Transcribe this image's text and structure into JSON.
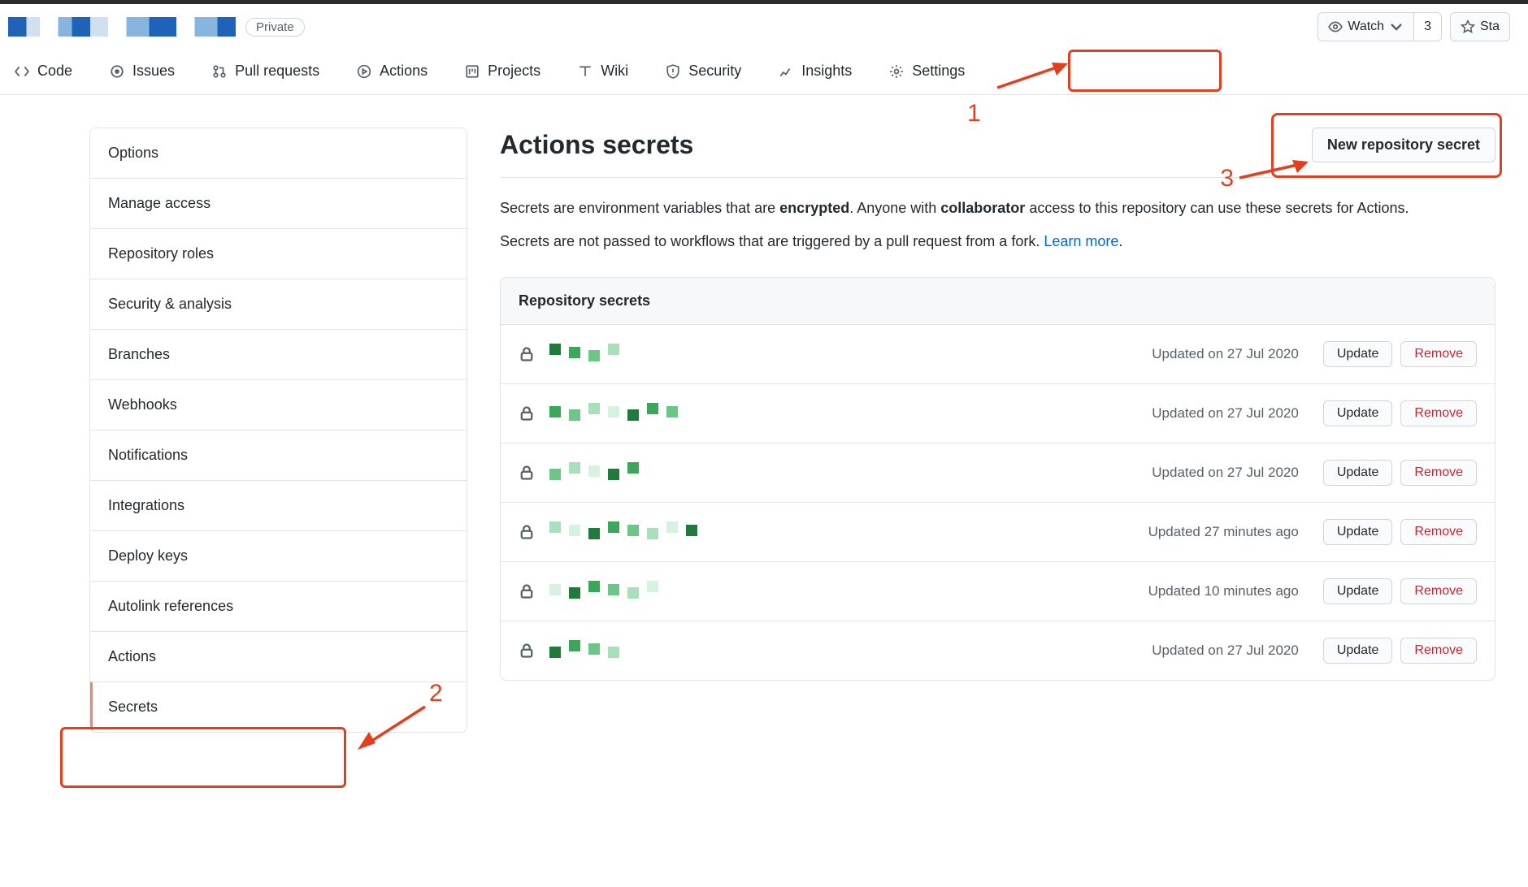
{
  "repo": {
    "visibility_badge": "Private"
  },
  "header_actions": {
    "watch_label": "Watch",
    "watch_count": "3",
    "star_label": "Sta"
  },
  "tabs": [
    {
      "icon": "code",
      "label": "Code"
    },
    {
      "icon": "issues",
      "label": "Issues"
    },
    {
      "icon": "pr",
      "label": "Pull requests"
    },
    {
      "icon": "actions",
      "label": "Actions"
    },
    {
      "icon": "projects",
      "label": "Projects"
    },
    {
      "icon": "wiki",
      "label": "Wiki"
    },
    {
      "icon": "security",
      "label": "Security"
    },
    {
      "icon": "insights",
      "label": "Insights"
    },
    {
      "icon": "settings",
      "label": "Settings"
    }
  ],
  "sidebar": {
    "items": [
      "Options",
      "Manage access",
      "Repository roles",
      "Security & analysis",
      "Branches",
      "Webhooks",
      "Notifications",
      "Integrations",
      "Deploy keys",
      "Autolink references",
      "Actions",
      "Secrets"
    ],
    "active_index": 11
  },
  "main": {
    "title": "Actions secrets",
    "new_secret_btn": "New repository secret",
    "intro_line1_a": "Secrets are environment variables that are ",
    "intro_line1_b": "encrypted",
    "intro_line1_c": ". Anyone with ",
    "intro_line1_d": "collaborator",
    "intro_line1_e": " access to this repository can use these secrets for Actions.",
    "intro_line2_a": "Secrets are not passed to workflows that are triggered by a pull request from a fork. ",
    "intro_line2_link": "Learn more",
    "intro_line2_b": "."
  },
  "secrets_box": {
    "header": "Repository secrets",
    "update_label": "Update",
    "remove_label": "Remove",
    "rows": [
      {
        "updated": "Updated on 27 Jul 2020"
      },
      {
        "updated": "Updated on 27 Jul 2020"
      },
      {
        "updated": "Updated on 27 Jul 2020"
      },
      {
        "updated": "Updated 27 minutes ago"
      },
      {
        "updated": "Updated 10 minutes ago"
      },
      {
        "updated": "Updated on 27 Jul 2020"
      }
    ]
  },
  "annotations": {
    "n1": "1",
    "n2": "2",
    "n3": "3"
  }
}
